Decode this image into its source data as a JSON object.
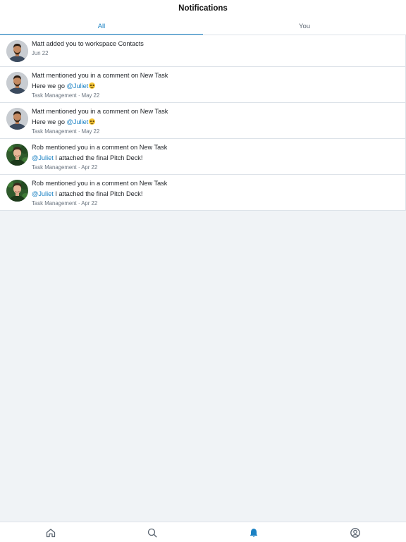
{
  "header": {
    "title": "Notifications",
    "tabs": [
      {
        "label": "All",
        "active": true
      },
      {
        "label": "You",
        "active": false
      }
    ]
  },
  "notifications": [
    {
      "actor": "Matt",
      "text": "added you to workspace",
      "target": "Contacts",
      "meta": "Jun 22",
      "avatar": "matt-avatar"
    },
    {
      "actor": "Matt",
      "text": "mentioned you in a comment on",
      "target": "New Task",
      "comment_prefix": "Here we go",
      "mention": "@Juliet",
      "comment_suffix": "",
      "emoji": "grinning-face",
      "meta": "Task Management · May 22",
      "avatar": "matt-avatar"
    },
    {
      "actor": "Matt",
      "text": "mentioned you in a comment on",
      "target": "New Task",
      "comment_prefix": "Here we go",
      "mention": "@Juliet",
      "comment_suffix": "",
      "emoji": "grinning-face",
      "meta": "Task Management · May 22",
      "avatar": "matt-avatar"
    },
    {
      "actor": "Rob",
      "text": "mentioned you in a comment on",
      "target": "New Task",
      "comment_prefix": "",
      "mention": "@Juliet",
      "comment_suffix": "I attached the final Pitch Deck!",
      "meta": "Task Management · Apr 22",
      "avatar": "rob-avatar"
    },
    {
      "actor": "Rob",
      "text": "mentioned you in a comment on",
      "target": "New Task",
      "comment_prefix": "",
      "mention": "@Juliet",
      "comment_suffix": "I attached the final Pitch Deck!",
      "meta": "Task Management · Apr 22",
      "avatar": "rob-avatar"
    }
  ],
  "bottom_nav": [
    {
      "icon": "home-icon",
      "active": false
    },
    {
      "icon": "search-icon",
      "active": false
    },
    {
      "icon": "bell-icon",
      "active": true
    },
    {
      "icon": "profile-icon",
      "active": false
    }
  ],
  "colors": {
    "accent": "#1b82c4",
    "background": "#f0f3f6",
    "divider": "#dde3e9",
    "muted_text": "#6b7580"
  }
}
